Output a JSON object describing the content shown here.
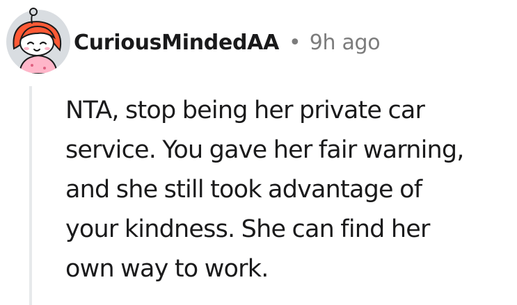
{
  "comment": {
    "author": "CuriousMindedAA",
    "separator": "•",
    "time_ago": "9h ago",
    "avatar_icon": "snoo-avatar-icon",
    "body_lines": [
      "NTA, stop being her private car",
      "service. You gave her fair warning,",
      "and she still took advantage of",
      "your kindness. She can find her",
      "own way to work."
    ]
  },
  "colors": {
    "text": "#1a1a1b",
    "meta": "#7c7c7c",
    "thread_line": "#e7e9eb",
    "avatar_bg": "#d9dde1",
    "hair": "#ff5a36",
    "shirt": "#ffb6c9"
  }
}
